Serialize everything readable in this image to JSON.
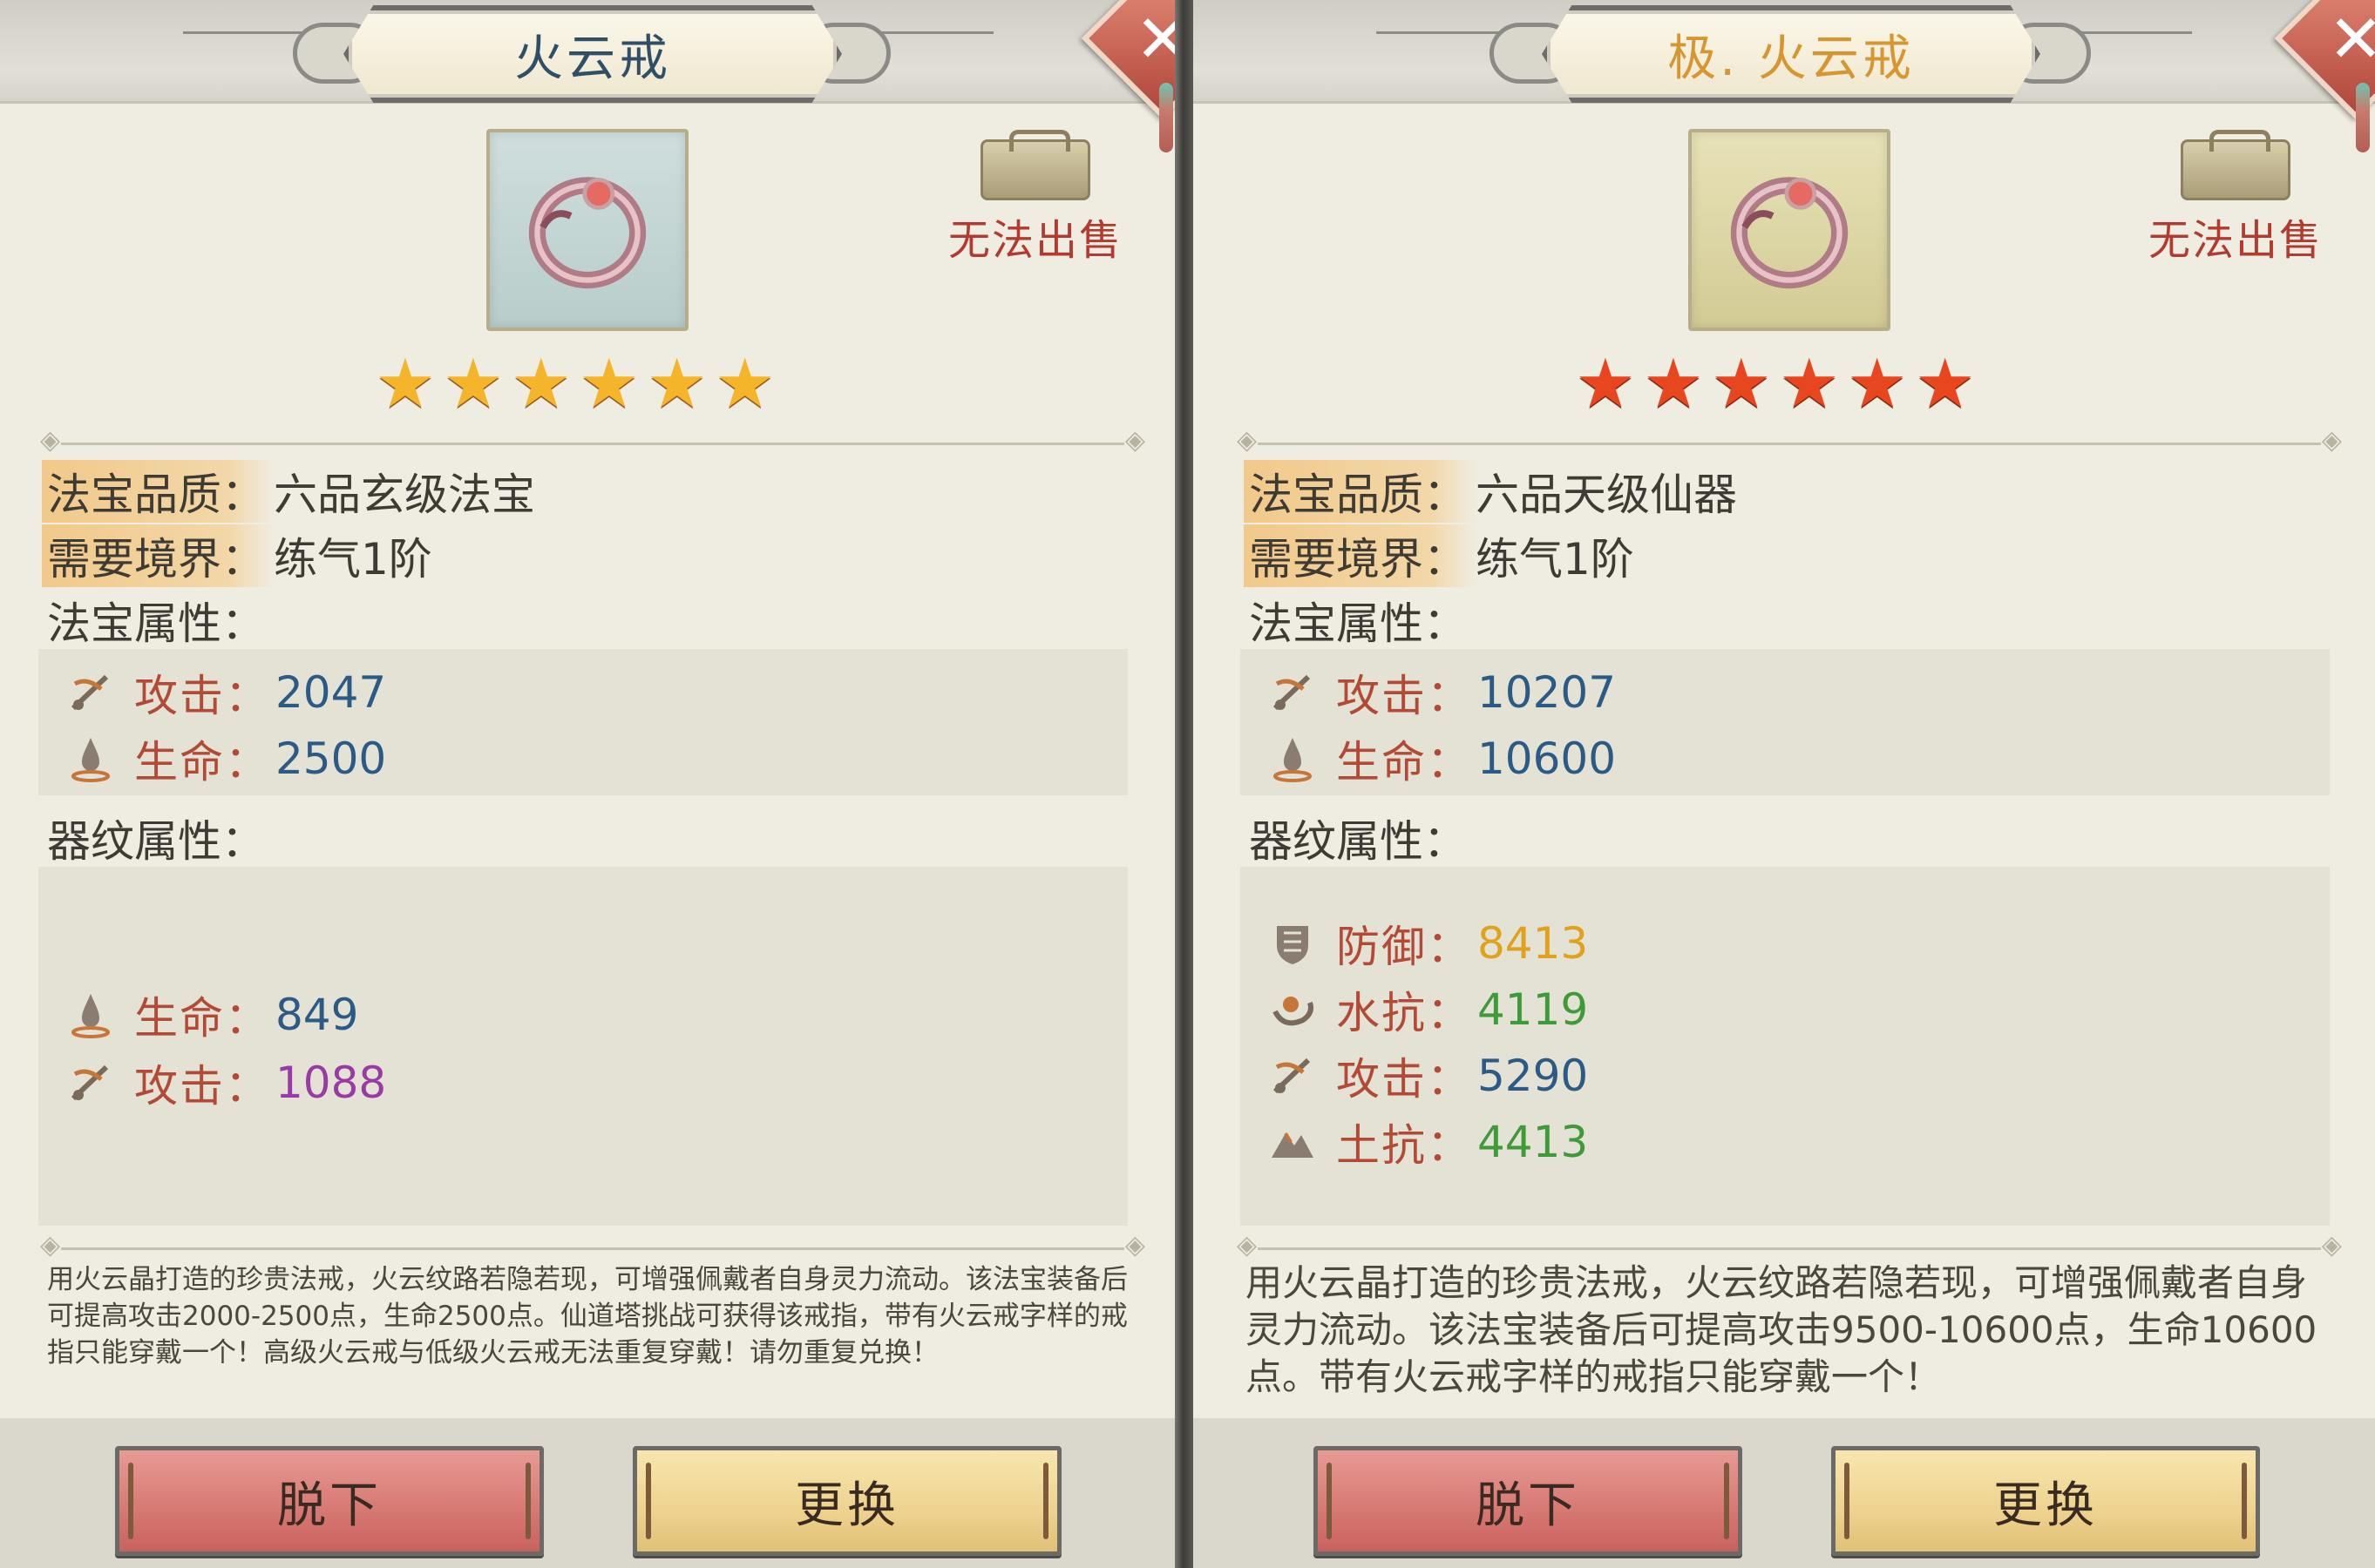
{
  "left": {
    "title": "火云戒",
    "title_color": "#2f4f66",
    "no_sell": "无法出售",
    "stars": [
      "★",
      "★",
      "★",
      "★",
      "★",
      "★"
    ],
    "star_color": "#f5b52b",
    "quality_label": "法宝品质：",
    "quality_value": "六品玄级法宝",
    "realm_label": "需要境界：",
    "realm_value": "练气1阶",
    "attr_title": "法宝属性：",
    "attrs": [
      {
        "icon": "sword-icon",
        "label": "攻击：",
        "value": "2047",
        "color": "#2b5a86"
      },
      {
        "icon": "hp-drop-icon",
        "label": "生命：",
        "value": "2500",
        "color": "#2b5a86"
      }
    ],
    "pattern_title": "器纹属性：",
    "patterns": [
      {
        "icon": "hp-drop-icon",
        "label": "生命：",
        "value": "849",
        "color": "#2b5a86"
      },
      {
        "icon": "sword-icon",
        "label": "攻击：",
        "value": "1088",
        "color": "#9a3aa6"
      }
    ],
    "description": "用火云晶打造的珍贵法戒，火云纹路若隐若现，可增强佩戴者自身灵力流动。该法宝装备后可提高攻击2000-2500点，生命2500点。仙道塔挑战可获得该戒指，带有火云戒字样的戒指只能穿戴一个！高级火云戒与低级火云戒无法重复穿戴！请勿重复兑换！",
    "btn_remove": "脱下",
    "btn_change": "更换"
  },
  "right": {
    "title": "极. 火云戒",
    "title_color": "#d79630",
    "no_sell": "无法出售",
    "stars": [
      "★",
      "★",
      "★",
      "★",
      "★",
      "★"
    ],
    "star_color": "#e8461f",
    "quality_label": "法宝品质：",
    "quality_value": "六品天级仙器",
    "realm_label": "需要境界：",
    "realm_value": "练气1阶",
    "attr_title": "法宝属性：",
    "attrs": [
      {
        "icon": "sword-icon",
        "label": "攻击：",
        "value": "10207",
        "color": "#2b5a86"
      },
      {
        "icon": "hp-drop-icon",
        "label": "生命：",
        "value": "10600",
        "color": "#2b5a86"
      }
    ],
    "pattern_title": "器纹属性：",
    "patterns": [
      {
        "icon": "armor-icon",
        "label": "防御：",
        "value": "8413",
        "color": "#e0a21d"
      },
      {
        "icon": "water-icon",
        "label": "水抗：",
        "value": "4119",
        "color": "#3f9a3a"
      },
      {
        "icon": "sword-icon",
        "label": "攻击：",
        "value": "5290",
        "color": "#2b5a86"
      },
      {
        "icon": "earth-icon",
        "label": "土抗：",
        "value": "4413",
        "color": "#3f9a3a"
      }
    ],
    "description": "用火云晶打造的珍贵法戒，火云纹路若隐若现，可增强佩戴者自身灵力流动。该法宝装备后可提高攻击9500-10600点，生命10600点。带有火云戒字样的戒指只能穿戴一个！",
    "btn_remove": "脱下",
    "btn_change": "更换"
  },
  "close_icon": "close-icon"
}
